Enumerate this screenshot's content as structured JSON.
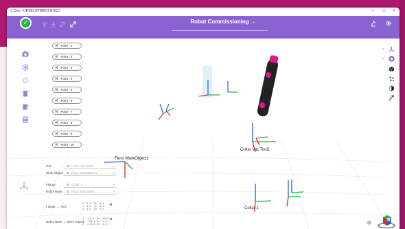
{
  "window": {
    "title": "Ξ Cixo - DEVELOPMENT BUILD",
    "minimize": "–",
    "maximize": "□",
    "close": "×"
  },
  "toolbar": {
    "status_icon": "✓",
    "app_title": "Robot Commissioning",
    "title_chevron": "⌄",
    "icons": [
      "wifi-icon",
      "download-icon",
      "link-icon",
      "expand-icon"
    ],
    "right_icons": [
      "robot-arm-icon",
      "settings-icon"
    ]
  },
  "left_toolbar": [
    "camera-icon",
    "target-icon",
    "record-icon",
    "trash-icon",
    "delete-list-icon",
    "calculator-icon"
  ],
  "points": [
    "Point - 1",
    "Point - 2",
    "Point - 3",
    "Point - 4",
    "Point - 5",
    "Point - 6",
    "Point - 7",
    "Point - 8",
    "Point - 9",
    "Point - 10"
  ],
  "form": {
    "tool_label": "Tool",
    "tool_placeholder": "Collar Vac Tool1",
    "work_object_label": "Work Object",
    "work_object_placeholder": "Floor WorkObject1",
    "flange_label": "Flange",
    "flange_placeholder": "Collar 1",
    "robot_base_label": "Robot Base",
    "robot_base_placeholder": "Floor RobotBase",
    "flange_tool_label": "Flange → Tool:",
    "robot_base_wo_label": "Robot Base → Work Object:",
    "matrix1": "X  0.0  Rx  0.0\nY  0.0  Ry  0.0\nZ  0.0  Rz  0.0",
    "matrix2": "X  -10.0  Rx  90.0\nY  -400.0 Ry  0.0\nZ  -170.0 Rz  0.0"
  },
  "scene": {
    "label_floor": "Floor WorkObject1",
    "label_collar_vac": "Collar Vac Tool1",
    "label_collar": "Collar 1",
    "axis_x_color": "#e02020",
    "axis_y_color": "#20b040",
    "axis_z_color": "#1f5fd0",
    "tool_color": "#d81b8e"
  },
  "right_toolbar": {
    "items": [
      "axes-icon",
      "tool-icon",
      "cube-icon",
      "points-icon",
      "sphere-icon",
      "path-icon"
    ],
    "checks": [
      "✓",
      "✓"
    ]
  },
  "nav_cube_face": "R",
  "colors": {
    "accent": "#8a63d2",
    "status_ok": "#2db04a",
    "background": "#b0186e"
  }
}
